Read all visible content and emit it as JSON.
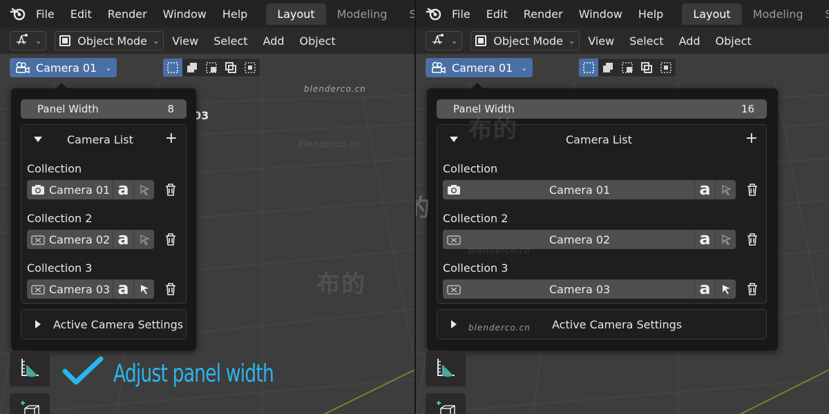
{
  "menubar": {
    "items": [
      "File",
      "Edit",
      "Render",
      "Window",
      "Help"
    ],
    "workspace_tabs": [
      "Layout",
      "Modeling",
      "Scul"
    ]
  },
  "header": {
    "editor_type_icon": "transform-gizmo-icon",
    "mode": "Object Mode",
    "menus": [
      "View",
      "Select",
      "Add",
      "Object"
    ]
  },
  "camera_selector": {
    "label": "Camera 01"
  },
  "watermarks": {
    "latin": "blenderco.cn",
    "cjk": "布的"
  },
  "panels": [
    {
      "panel_width_label": "Panel Width",
      "panel_width_value": "8",
      "camera_list_title": "Camera List",
      "collections": [
        {
          "label": "Collection",
          "camera": "Camera 01",
          "icon": "camera-icon",
          "selected": false
        },
        {
          "label": "Collection 2",
          "camera": "Camera 02",
          "icon": "camera-inactive-icon",
          "selected": false
        },
        {
          "label": "Collection 3",
          "camera": "Camera 03",
          "icon": "camera-inactive-icon",
          "selected": true
        }
      ],
      "active_settings_title": "Active Camera Settings"
    },
    {
      "panel_width_label": "Panel Width",
      "panel_width_value": "16",
      "camera_list_title": "Camera List",
      "collections": [
        {
          "label": "Collection",
          "camera": "Camera 01",
          "icon": "camera-icon",
          "selected": false
        },
        {
          "label": "Collection 2",
          "camera": "Camera 02",
          "icon": "camera-inactive-icon",
          "selected": false
        },
        {
          "label": "Collection 3",
          "camera": "Camera 03",
          "icon": "camera-inactive-icon",
          "selected": true
        }
      ],
      "active_settings_title": "Active Camera Settings"
    }
  ],
  "peek_text": "03",
  "caption": {
    "text": "Adjust panel width",
    "color": "#2bb5ee"
  },
  "colors": {
    "accent": "#4a6fa5",
    "panel_bg": "#181818",
    "field_bg": "#4e4e4e"
  }
}
